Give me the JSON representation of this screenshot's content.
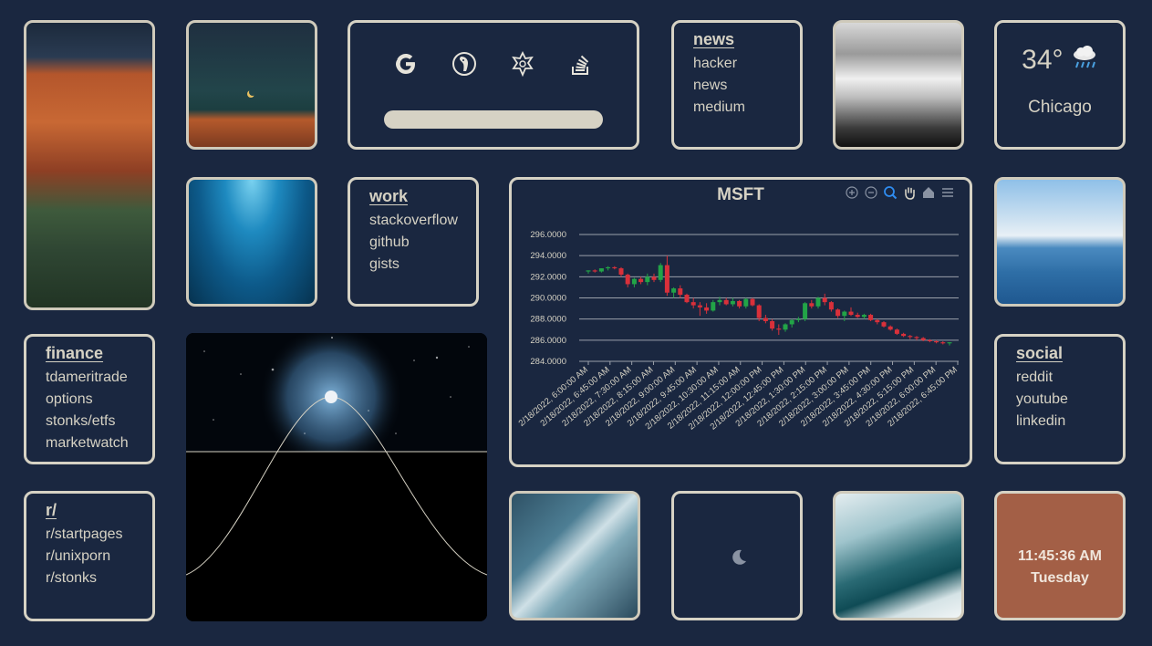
{
  "search": {
    "engines": [
      "google",
      "duckduckgo",
      "wolframalpha",
      "stackoverflow"
    ],
    "placeholder": ""
  },
  "news": {
    "title": "news",
    "links": [
      "hacker",
      "news",
      "medium"
    ]
  },
  "work": {
    "title": "work",
    "links": [
      "stackoverflow",
      "github",
      "gists"
    ]
  },
  "finance": {
    "title": "finance",
    "links": [
      "tdameritrade",
      "options",
      "stonks/etfs",
      "marketwatch"
    ]
  },
  "reddit": {
    "title": "r/",
    "links": [
      "r/startpages",
      "r/unixporn",
      "r/stonks"
    ]
  },
  "social": {
    "title": "social",
    "links": [
      "reddit",
      "youtube",
      "linkedin"
    ]
  },
  "weather": {
    "temp": "34°",
    "icon": "rain-cloud-icon",
    "city": "Chicago"
  },
  "clock": {
    "time": "11:45:36 AM",
    "day": "Tuesday",
    "bg": "#a35f46"
  },
  "colors": {
    "background": "#1a2740",
    "border": "#d6d2c4",
    "up": "#22a447",
    "down": "#d9303a"
  },
  "chart_data": {
    "type": "candlestick",
    "title": "MSFT",
    "ylim": [
      284,
      296
    ],
    "yticks": [
      "296.0000",
      "294.0000",
      "292.0000",
      "290.0000",
      "288.0000",
      "286.0000",
      "284.0000"
    ],
    "xticks": [
      "2/18/2022, 6:00:00 AM",
      "2/18/2022, 6:45:00 AM",
      "2/18/2022, 7:30:00 AM",
      "2/18/2022, 8:15:00 AM",
      "2/18/2022, 9:00:00 AM",
      "2/18/2022, 9:45:00 AM",
      "2/18/2022, 10:30:00 AM",
      "2/18/2022, 11:15:00 AM",
      "2/18/2022, 12:00:00 PM",
      "2/18/2022, 12:45:00 PM",
      "2/18/2022, 1:30:00 PM",
      "2/18/2022, 2:15:00 PM",
      "2/18/2022, 3:00:00 PM",
      "2/18/2022, 3:45:00 PM",
      "2/18/2022, 4:30:00 PM",
      "2/18/2022, 5:15:00 PM",
      "2/18/2022, 6:00:00 PM",
      "2/18/2022, 6:45:00 PM"
    ],
    "candles": [
      [
        292.5,
        292.6,
        292.3,
        292.6
      ],
      [
        292.6,
        292.7,
        292.4,
        292.5
      ],
      [
        292.5,
        292.8,
        292.4,
        292.8
      ],
      [
        292.8,
        293.0,
        292.6,
        292.9
      ],
      [
        292.9,
        293.0,
        292.7,
        292.8
      ],
      [
        292.8,
        292.9,
        292.0,
        292.2
      ],
      [
        292.2,
        292.3,
        291.0,
        291.3
      ],
      [
        291.3,
        291.9,
        291.0,
        291.8
      ],
      [
        291.8,
        292.0,
        291.3,
        291.5
      ],
      [
        291.5,
        292.3,
        291.2,
        292.0
      ],
      [
        292.0,
        292.3,
        291.5,
        291.7
      ],
      [
        291.7,
        293.3,
        291.5,
        293.1
      ],
      [
        293.1,
        294.0,
        290.2,
        290.5
      ],
      [
        290.5,
        291.0,
        290.0,
        290.9
      ],
      [
        290.9,
        291.2,
        290.0,
        290.3
      ],
      [
        290.3,
        290.4,
        289.5,
        289.6
      ],
      [
        289.6,
        290.0,
        289.0,
        289.3
      ],
      [
        289.3,
        289.6,
        288.3,
        289.1
      ],
      [
        289.1,
        289.5,
        288.5,
        288.8
      ],
      [
        288.8,
        289.8,
        288.7,
        289.6
      ],
      [
        289.6,
        290.1,
        289.3,
        289.8
      ],
      [
        289.8,
        290.0,
        289.3,
        289.4
      ],
      [
        289.4,
        290.0,
        289.2,
        289.7
      ],
      [
        289.7,
        289.8,
        289.0,
        289.2
      ],
      [
        289.2,
        290.0,
        289.0,
        289.9
      ],
      [
        289.9,
        290.0,
        289.2,
        289.3
      ],
      [
        289.3,
        289.4,
        287.8,
        288.1
      ],
      [
        288.1,
        288.4,
        287.6,
        287.8
      ],
      [
        287.8,
        288.0,
        286.9,
        287.1
      ],
      [
        287.1,
        287.5,
        286.5,
        287.0
      ],
      [
        287.0,
        287.6,
        286.8,
        287.5
      ],
      [
        287.5,
        288.0,
        287.2,
        287.9
      ],
      [
        287.9,
        288.2,
        287.7,
        288.0
      ],
      [
        288.0,
        289.6,
        287.8,
        289.5
      ],
      [
        289.5,
        289.8,
        289.0,
        289.2
      ],
      [
        289.2,
        290.1,
        289.0,
        290.0
      ],
      [
        290.0,
        290.4,
        289.3,
        289.6
      ],
      [
        289.6,
        289.7,
        288.7,
        288.9
      ],
      [
        288.9,
        289.0,
        288.1,
        288.3
      ],
      [
        288.3,
        288.8,
        287.8,
        288.7
      ],
      [
        288.7,
        289.1,
        288.3,
        288.4
      ],
      [
        288.4,
        288.6,
        288.1,
        288.2
      ],
      [
        288.2,
        288.5,
        288.0,
        288.4
      ],
      [
        288.4,
        288.5,
        287.8,
        287.9
      ],
      [
        287.9,
        288.0,
        287.5,
        287.7
      ],
      [
        287.7,
        287.8,
        287.2,
        287.3
      ],
      [
        287.3,
        287.4,
        286.9,
        287.0
      ],
      [
        287.0,
        287.1,
        286.5,
        286.6
      ],
      [
        286.6,
        286.7,
        286.3,
        286.4
      ],
      [
        286.4,
        286.5,
        286.1,
        286.3
      ],
      [
        286.3,
        286.4,
        286.0,
        286.2
      ],
      [
        286.2,
        286.3,
        285.9,
        286.0
      ],
      [
        286.0,
        286.1,
        285.8,
        285.9
      ],
      [
        285.9,
        286.0,
        285.7,
        285.8
      ],
      [
        285.8,
        285.9,
        285.6,
        285.7
      ],
      [
        285.7,
        285.8,
        285.5,
        285.8
      ]
    ]
  }
}
